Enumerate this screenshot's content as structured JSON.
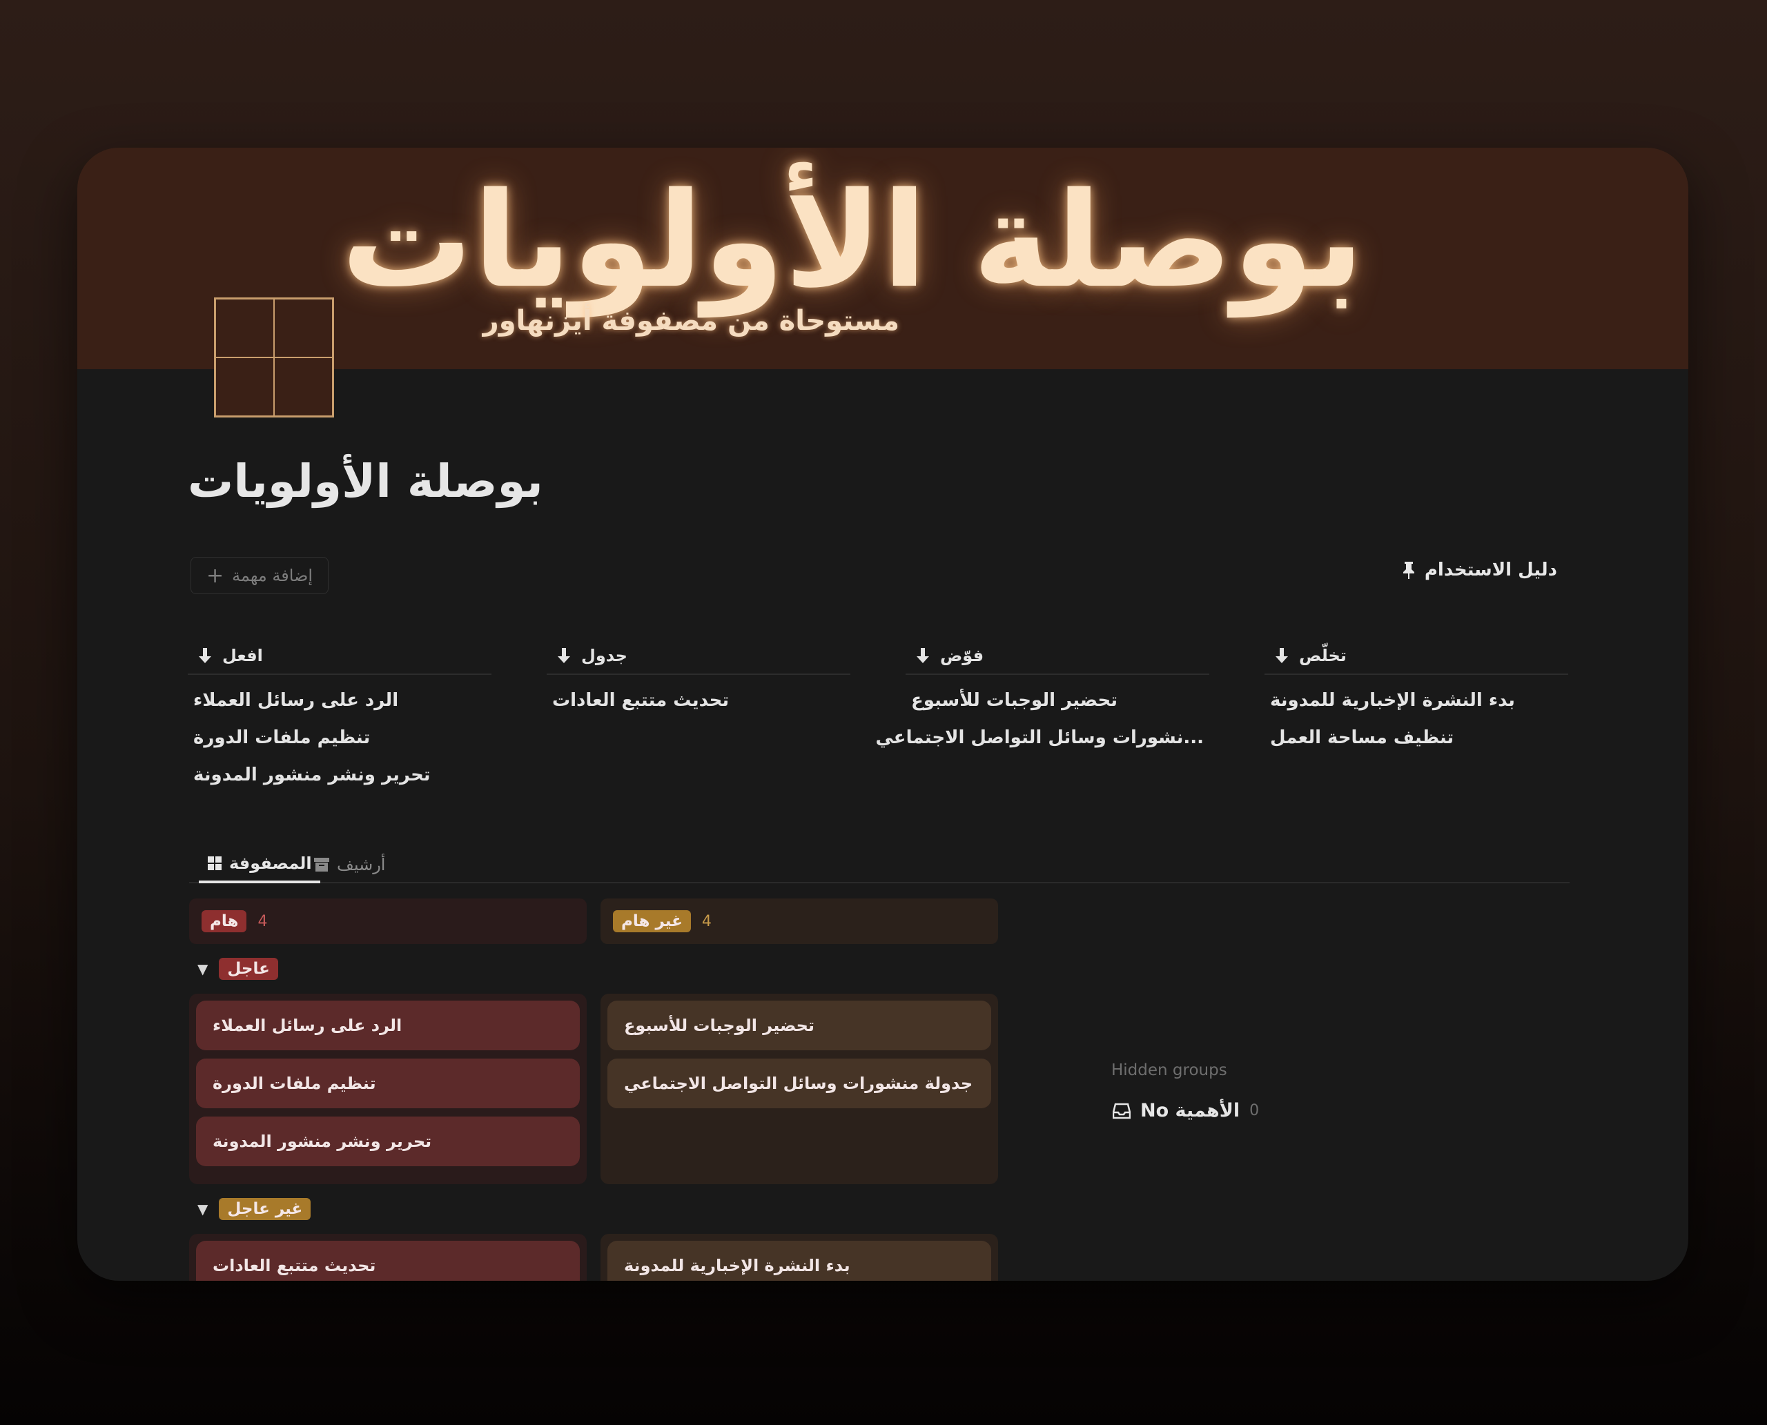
{
  "banner": {
    "title": "بوصلة الأولويات",
    "subtitle": "مستوحاة من مصفوفة أيزنهاور"
  },
  "page": {
    "title": "بوصلة الأولويات",
    "add_task_label": "إضافة مهمة",
    "guide_label": "دليل الاستخدام"
  },
  "quadrants": [
    {
      "title": "افعل",
      "items": [
        "الرد على رسائل العملاء",
        "تنظيم ملفات الدورة",
        "تحرير ونشر منشور المدونة"
      ]
    },
    {
      "title": "جدول",
      "items": [
        "تحديث متتبع العادات"
      ]
    },
    {
      "title": "فوّض",
      "items": [
        "تحضير الوجبات للأسبوع",
        "...نشورات وسائل التواصل الاجتماعي"
      ]
    },
    {
      "title": "تخلّص",
      "items": [
        "بدء النشرة الإخبارية للمدونة",
        "تنظيف مساحة العمل"
      ]
    }
  ],
  "tabs": {
    "matrix": "المصفوفة",
    "archive": "أرشيف"
  },
  "board": {
    "columns": [
      {
        "label": "هام",
        "count": "4",
        "color": "#8e2f2f"
      },
      {
        "label": "غير هام",
        "count": "4",
        "color": "#a87a2a"
      }
    ],
    "groups": [
      {
        "label": "عاجل",
        "important": [
          "الرد على رسائل العملاء",
          "تنظيم ملفات الدورة",
          "تحرير ونشر منشور المدونة"
        ],
        "not_important": [
          "تحضير الوجبات للأسبوع",
          "جدولة منشورات وسائل التواصل الاجتماعي"
        ]
      },
      {
        "label": "غير عاجل",
        "important": [
          "تحديث متتبع العادات"
        ],
        "not_important": [
          "بدء النشرة الإخبارية للمدونة"
        ]
      }
    ],
    "hidden_groups_label": "Hidden groups",
    "no_importance_label": "No الأهمية",
    "no_importance_count": "0"
  },
  "colors": {
    "banner_bg": "#3a2016",
    "important_card": "#5c2a2a",
    "not_important_card": "#463426",
    "urgent_pill": "#8e2f2f",
    "not_urgent_pill": "#a87a2a"
  }
}
